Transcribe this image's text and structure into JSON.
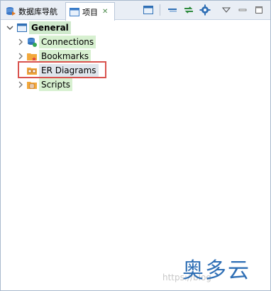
{
  "tabs": [
    {
      "label": "数据库导航",
      "active": false,
      "icon": "database-navigator-icon"
    },
    {
      "label": "项目",
      "active": true,
      "icon": "projects-icon"
    }
  ],
  "toolbar": {
    "buttons": [
      "new-project-icon",
      "collapse-all-icon",
      "link-with-editor-icon",
      "configure-icon",
      "view-menu-icon",
      "minimize-icon",
      "maximize-icon"
    ]
  },
  "tree": {
    "root": {
      "label": "General",
      "expanded": true,
      "icon": "project-folder-icon"
    },
    "children": [
      {
        "label": "Connections",
        "icon": "connections-icon"
      },
      {
        "label": "Bookmarks",
        "icon": "bookmarks-folder-icon"
      },
      {
        "label": "ER Diagrams",
        "icon": "er-diagrams-folder-icon",
        "highlighted": true
      },
      {
        "label": "Scripts",
        "icon": "scripts-folder-icon"
      }
    ]
  },
  "watermark": {
    "url": "https://blog",
    "brand": "奥多云"
  },
  "colors": {
    "highlight_border": "#d9534f",
    "label_bg": "#d7f0d0",
    "accent": "#2f6fb5"
  }
}
